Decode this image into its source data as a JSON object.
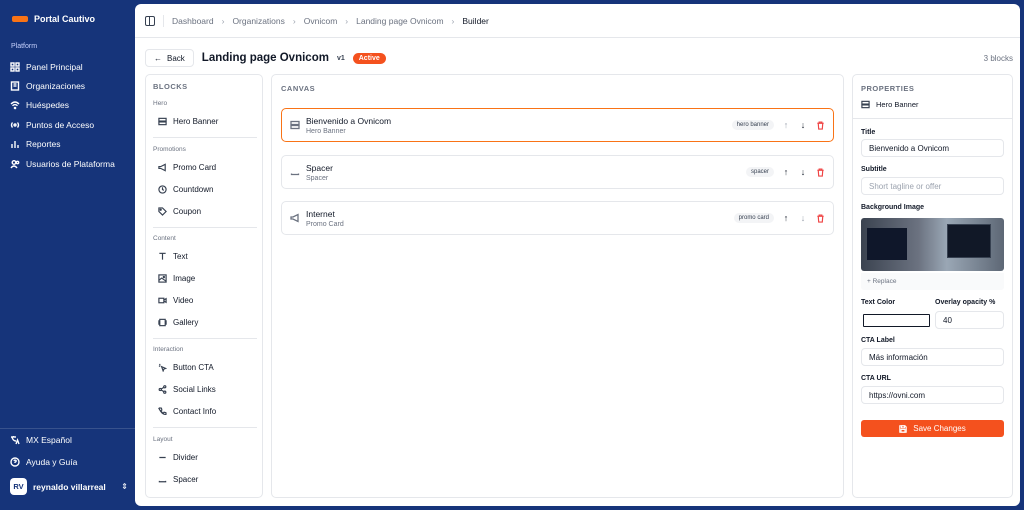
{
  "brand": {
    "title": "Portal Cautivo",
    "accent": "#f97316"
  },
  "sidebar": {
    "section_label": "Platform",
    "items": [
      {
        "label": "Panel Principal",
        "icon": "grid-icon"
      },
      {
        "label": "Organizaciones",
        "icon": "building-icon"
      },
      {
        "label": "Huéspedes",
        "icon": "wifi-icon"
      },
      {
        "label": "Puntos de Acceso",
        "icon": "access-point-icon"
      },
      {
        "label": "Reportes",
        "icon": "chart-icon"
      },
      {
        "label": "Usuarios de Plataforma",
        "icon": "users-icon"
      }
    ],
    "language": "MX Español",
    "help": "Ayuda y Guía",
    "user": {
      "initials": "RV",
      "name": "reynaldo villarreal"
    }
  },
  "breadcrumb": [
    "Dashboard",
    "Organizations",
    "Ovnicom",
    "Landing page Ovnicom",
    "Builder"
  ],
  "header": {
    "back_label": "Back",
    "title": "Landing page Ovnicom",
    "version": "v1",
    "status": "Active",
    "block_count": "3 blocks"
  },
  "blocks_panel": {
    "heading": "BLOCKS",
    "groups": [
      {
        "label": "Hero",
        "items": [
          "Hero Banner"
        ]
      },
      {
        "label": "Promotions",
        "items": [
          "Promo Card",
          "Countdown",
          "Coupon"
        ]
      },
      {
        "label": "Content",
        "items": [
          "Text",
          "Image",
          "Video",
          "Gallery"
        ]
      },
      {
        "label": "Interaction",
        "items": [
          "Button CTA",
          "Social Links",
          "Contact Info"
        ]
      },
      {
        "label": "Layout",
        "items": [
          "Divider",
          "Spacer"
        ]
      }
    ]
  },
  "canvas": {
    "heading": "CANVAS",
    "cards": [
      {
        "title": "Bienvenido a Ovnicom",
        "subtitle": "Hero Banner",
        "type": "hero banner",
        "selected": true
      },
      {
        "title": "Spacer",
        "subtitle": "Spacer",
        "type": "spacer",
        "selected": false
      },
      {
        "title": "Internet",
        "subtitle": "Promo Card",
        "type": "promo card",
        "selected": false
      }
    ]
  },
  "properties": {
    "heading": "PROPERTIES",
    "selected_block": "Hero Banner",
    "title_label": "Title",
    "title_value": "Bienvenido a Ovnicom",
    "subtitle_label": "Subtitle",
    "subtitle_placeholder": "Short tagline or offer",
    "bg_label": "Background Image",
    "replace_label": "+ Replace",
    "text_color_label": "Text Color",
    "text_color_value": "#ffffff",
    "overlay_label": "Overlay opacity %",
    "overlay_value": "40",
    "cta_label_label": "CTA Label",
    "cta_label_value": "Más información",
    "cta_url_label": "CTA URL",
    "cta_url_value": "https://ovni.com",
    "save_label": "Save Changes"
  }
}
